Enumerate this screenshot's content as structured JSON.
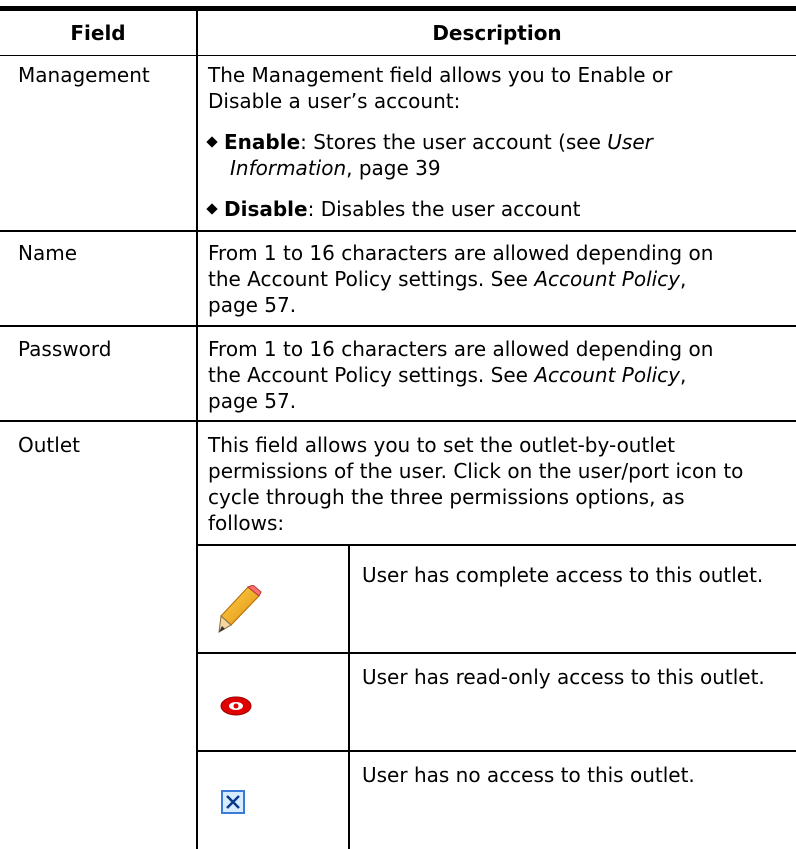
{
  "table": {
    "headers": {
      "field": "Field",
      "description": "Description"
    },
    "rows": {
      "management": {
        "field": "Management",
        "desc_line1": "The Management field allows you to Enable or",
        "desc_line2": "Disable a user’s account:",
        "enable_term": "Enable",
        "enable_text1": ": Stores the user account (see ",
        "enable_ref1": "User",
        "enable_ref2": "Information",
        "enable_text2": ", page 39",
        "disable_term": "Disable",
        "disable_text": ": Disables the user account"
      },
      "name": {
        "field": "Name",
        "line1": "From 1 to 16 characters are allowed depending on",
        "line2a": "the Account Policy settings. See ",
        "line2ref": "Account Policy",
        "line2b": ",",
        "line3": "page 57."
      },
      "password": {
        "field": "Password",
        "line1": "From 1 to 16 characters are allowed depending on",
        "line2a": "the Account Policy settings. See ",
        "line2ref": "Account Policy",
        "line2b": ",",
        "line3": "page 57."
      },
      "outlet": {
        "field": "Outlet",
        "line1": "This field allows you to set the outlet-by-outlet",
        "line2": "permissions of the user. Click on the user/port icon to",
        "line3": "cycle through the three permissions options, as",
        "line4": "follows:",
        "permissions": [
          {
            "icon": "pencil-icon",
            "text": "User has complete access to this outlet."
          },
          {
            "icon": "eye-icon",
            "text": "User has read-only access to this outlet."
          },
          {
            "icon": "no-access-icon",
            "text": "User has no access to this outlet."
          }
        ]
      }
    }
  }
}
